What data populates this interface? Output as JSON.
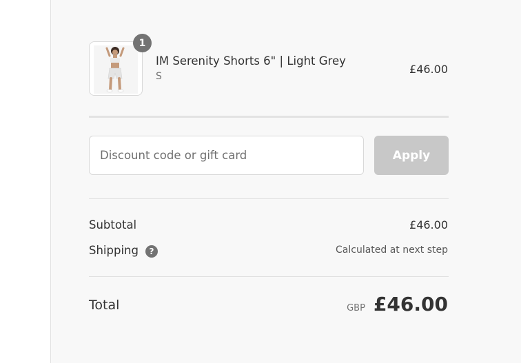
{
  "cart": {
    "item": {
      "quantity": "1",
      "name": "IM Serenity Shorts 6\" | Light Grey",
      "variant": "S",
      "price": "£46.00"
    }
  },
  "discount": {
    "placeholder": "Discount code or gift card",
    "apply_label": "Apply"
  },
  "summary": {
    "subtotal_label": "Subtotal",
    "subtotal_value": "£46.00",
    "shipping_label": "Shipping",
    "shipping_value": "Calculated at next step",
    "total_label": "Total",
    "currency": "GBP",
    "total_value": "£46.00"
  },
  "icons": {
    "shipping_help": "question-circle-icon"
  },
  "colors": {
    "apply_button_disabled": "#c8c8c8",
    "badge": "#737373",
    "summary_background": "#f8f8f8"
  }
}
